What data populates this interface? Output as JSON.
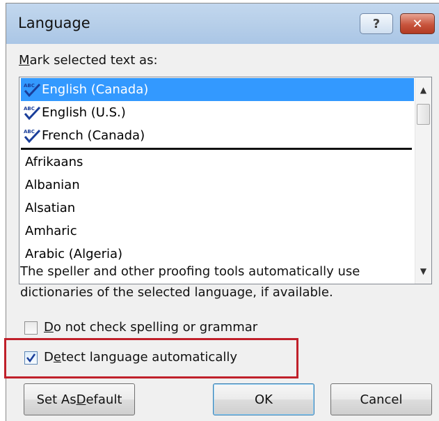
{
  "window": {
    "title": "Language",
    "help_glyph": "?",
    "close_glyph": "✕"
  },
  "list": {
    "label_mnemonic": "M",
    "label_rest": "ark selected text as:",
    "proofed_items": [
      "English (Canada)",
      "English (U.S.)",
      "French (Canada)"
    ],
    "other_items": [
      "Afrikaans",
      "Albanian",
      "Alsatian",
      "Amharic",
      "Arabic (Algeria)"
    ],
    "selected": "English (Canada)",
    "scroll_up": "▲",
    "scroll_down": "▼"
  },
  "description": {
    "line1": "The speller and other proofing tools automatically use",
    "line2": "dictionaries of the selected language, if available."
  },
  "options": {
    "no_check": {
      "mnemonic": "D",
      "rest": "o not check spelling or grammar",
      "checked": false
    },
    "detect": {
      "before": "D",
      "mnemonic": "e",
      "rest": "tect language automatically",
      "checked": true
    }
  },
  "buttons": {
    "default_pre": "Set As ",
    "default_mnemonic": "D",
    "default_rest": "efault",
    "ok": "OK",
    "cancel": "Cancel"
  },
  "colors": {
    "selection": "#3399ff",
    "highlight_border": "#c0202a",
    "spellcheck_icon": "#1a3e9a"
  },
  "icons": {
    "list_item_icon": "abc-spellcheck-icon",
    "help": "help-icon",
    "close": "close-icon",
    "checkbox_check": "checkmark-icon"
  }
}
